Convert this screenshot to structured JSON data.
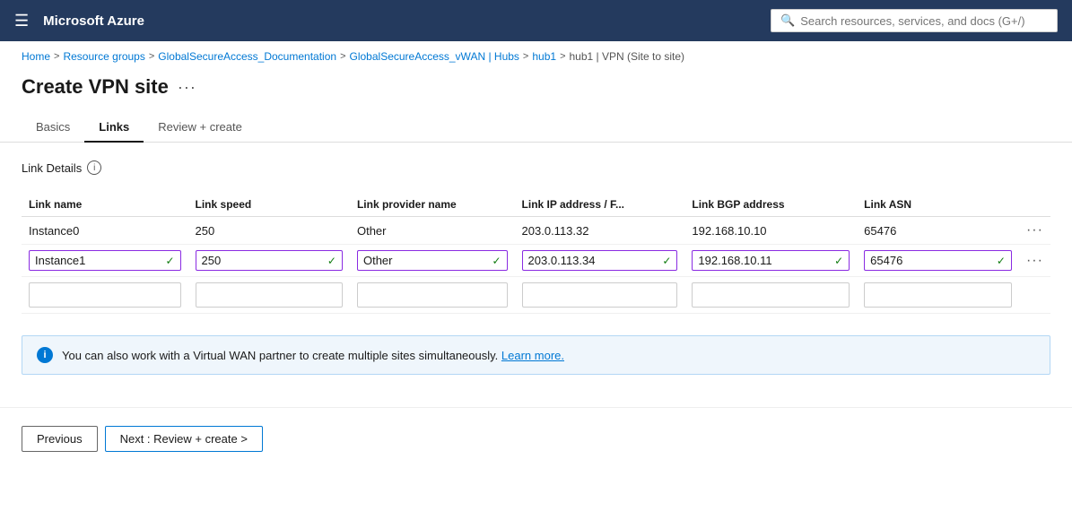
{
  "topNav": {
    "logo": "Microsoft Azure",
    "search": {
      "placeholder": "Search resources, services, and docs (G+/)"
    }
  },
  "breadcrumb": {
    "items": [
      {
        "label": "Home",
        "link": true
      },
      {
        "label": "Resource groups",
        "link": true
      },
      {
        "label": "GlobalSecureAccess_Documentation",
        "link": true
      },
      {
        "label": "GlobalSecureAccess_vWAN | Hubs",
        "link": true
      },
      {
        "label": "hub1",
        "link": true
      },
      {
        "label": "hub1 | VPN (Site to site)",
        "link": true
      }
    ]
  },
  "pageTitle": "Create VPN site",
  "tabs": [
    {
      "label": "Basics",
      "active": false
    },
    {
      "label": "Links",
      "active": true
    },
    {
      "label": "Review + create",
      "active": false
    }
  ],
  "sectionLabel": "Link Details",
  "table": {
    "columns": [
      "Link name",
      "Link speed",
      "Link provider name",
      "Link IP address / F...",
      "Link BGP address",
      "Link ASN"
    ],
    "staticRow": {
      "name": "Instance0",
      "speed": "250",
      "provider": "Other",
      "ip": "203.0.113.32",
      "bgp": "192.168.10.10",
      "asn": "65476"
    },
    "editRow": {
      "name": "Instance1",
      "speed": "250",
      "provider": "Other",
      "ip": "203.0.113.34",
      "bgp": "192.168.10.11",
      "asn": "65476"
    }
  },
  "infoBanner": {
    "text": "You can also work with a Virtual WAN partner to create multiple sites simultaneously.",
    "linkText": "Learn more."
  },
  "buttons": {
    "previous": "Previous",
    "next": "Next : Review + create >"
  },
  "icons": {
    "hamburger": "☰",
    "info": "i",
    "check": "✓",
    "dots": "···",
    "search": "🔍"
  }
}
